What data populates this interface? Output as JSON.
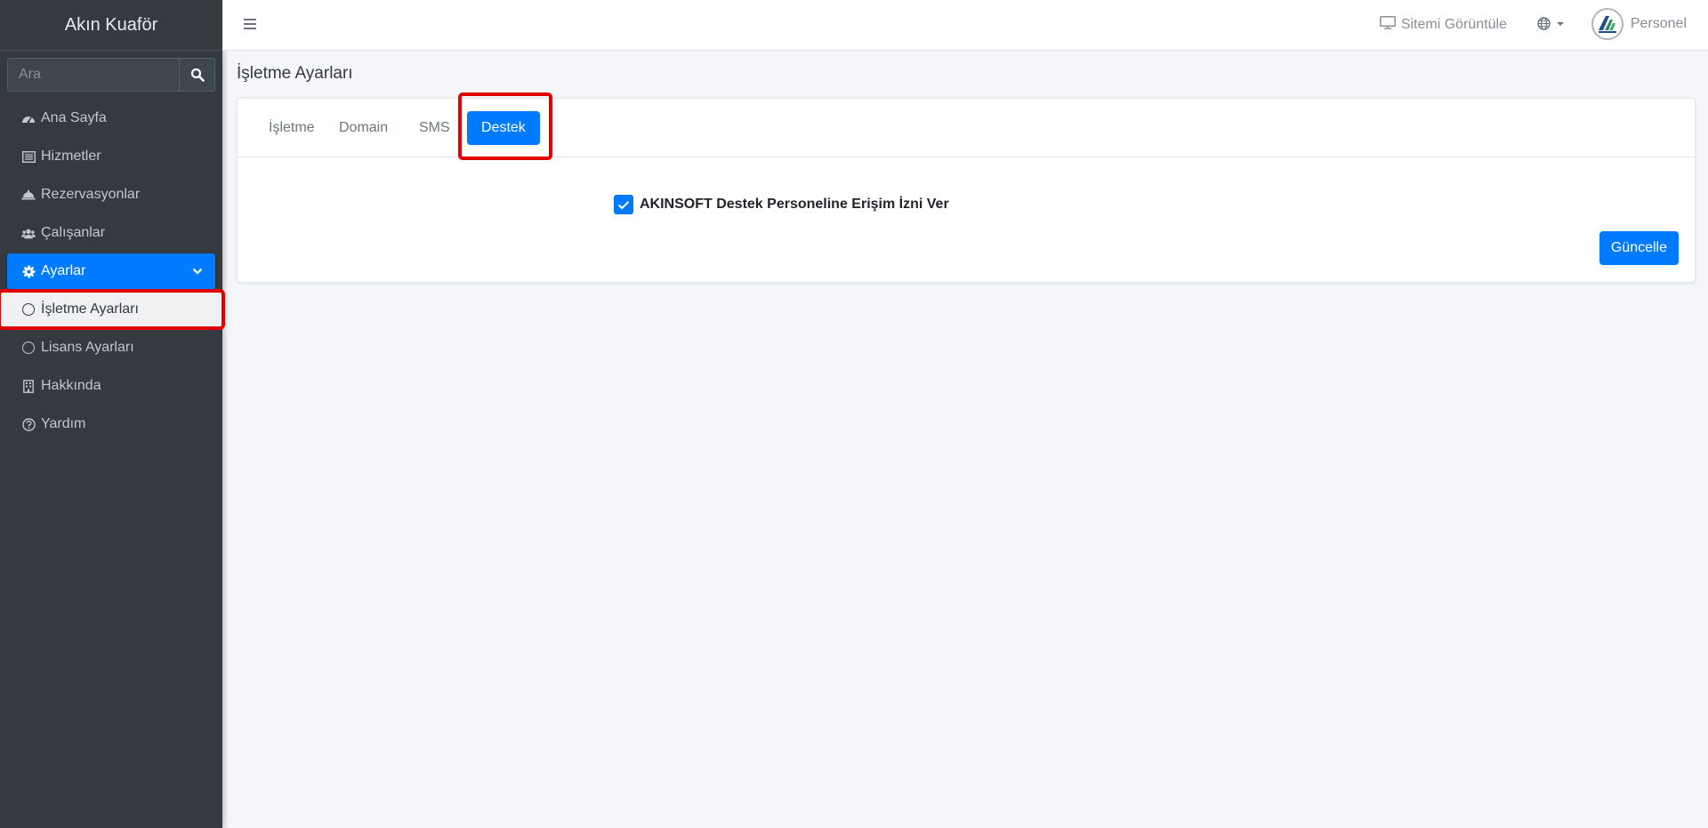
{
  "sidebar": {
    "brand": "Akın Kuaför",
    "search_placeholder": "Ara",
    "items": [
      {
        "label": "Ana Sayfa",
        "icon": "dashboard-icon"
      },
      {
        "label": "Hizmetler",
        "icon": "list-icon"
      },
      {
        "label": "Rezervasyonlar",
        "icon": "bell-concierge-icon"
      },
      {
        "label": "Çalışanlar",
        "icon": "users-icon"
      },
      {
        "label": "Ayarlar",
        "icon": "gear-icon"
      },
      {
        "label": "İşletme Ayarları",
        "icon": "circle-icon"
      },
      {
        "label": "Lisans Ayarları",
        "icon": "circle-icon"
      },
      {
        "label": "Hakkında",
        "icon": "building-icon"
      },
      {
        "label": "Yardım",
        "icon": "question-circle-icon"
      }
    ]
  },
  "header": {
    "view_site": "Sitemi Görüntüle",
    "user": "Personel"
  },
  "main": {
    "page_title": "İşletme Ayarları",
    "tabs": [
      {
        "label": "İşletme"
      },
      {
        "label": "Domain"
      },
      {
        "label": "SMS"
      },
      {
        "label": "Destek"
      }
    ],
    "support_checkbox_label": "AKINSOFT Destek Personeline Erişim İzni Ver",
    "support_checkbox_checked": true,
    "update_button": "Güncelle"
  },
  "colors": {
    "accent": "#007bff",
    "sidebar_bg": "#343a40",
    "highlight": "#e00000"
  }
}
